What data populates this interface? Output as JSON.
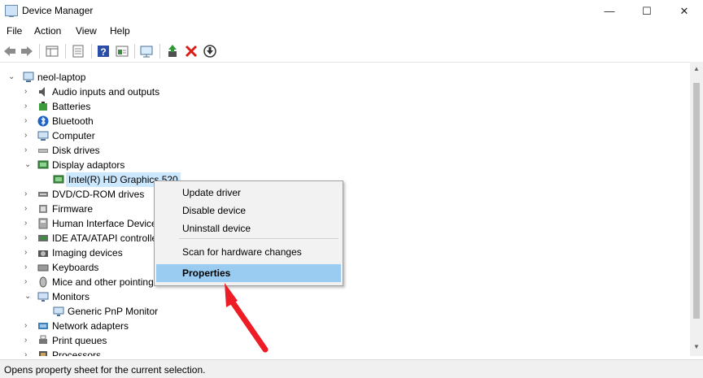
{
  "window": {
    "title": "Device Manager",
    "minimize_glyph": "—",
    "maximize_glyph": "☐",
    "close_glyph": "✕"
  },
  "menu": [
    "File",
    "Action",
    "View",
    "Help"
  ],
  "toolbar_icons": [
    "back-icon",
    "forward-icon",
    "show-hide-tree-icon",
    "properties-icon",
    "help-icon",
    "action-pane-icon",
    "monitor-icon",
    "update-driver-icon",
    "uninstall-icon",
    "download-icon"
  ],
  "tree": {
    "root": "neol-laptop",
    "items": [
      {
        "label": "Audio inputs and outputs",
        "icon": "speaker-icon",
        "expanded": false
      },
      {
        "label": "Batteries",
        "icon": "battery-icon",
        "expanded": false
      },
      {
        "label": "Bluetooth",
        "icon": "bluetooth-icon",
        "expanded": false
      },
      {
        "label": "Computer",
        "icon": "computer-icon",
        "expanded": false
      },
      {
        "label": "Disk drives",
        "icon": "disk-drive-icon",
        "expanded": false
      },
      {
        "label": "Display adaptors",
        "icon": "display-adapter-icon",
        "expanded": true,
        "children": [
          {
            "label": "Intel(R) HD Graphics 520",
            "icon": "display-adapter-icon",
            "selected": true
          }
        ]
      },
      {
        "label": "DVD/CD-ROM drives",
        "icon": "dvd-icon",
        "expanded": false
      },
      {
        "label": "Firmware",
        "icon": "firmware-icon",
        "expanded": false
      },
      {
        "label": "Human Interface Devices",
        "icon": "hid-icon",
        "expanded": false
      },
      {
        "label": "IDE ATA/ATAPI controllers",
        "icon": "ide-icon",
        "expanded": false
      },
      {
        "label": "Imaging devices",
        "icon": "camera-icon",
        "expanded": false
      },
      {
        "label": "Keyboards",
        "icon": "keyboard-icon",
        "expanded": false
      },
      {
        "label": "Mice and other pointing devices",
        "icon": "mouse-icon",
        "expanded": false
      },
      {
        "label": "Monitors",
        "icon": "monitor-icon",
        "expanded": true,
        "children": [
          {
            "label": "Generic PnP Monitor",
            "icon": "monitor-icon"
          }
        ]
      },
      {
        "label": "Network adapters",
        "icon": "network-icon",
        "expanded": false
      },
      {
        "label": "Print queues",
        "icon": "printer-icon",
        "expanded": false
      },
      {
        "label": "Processors",
        "icon": "processor-icon",
        "expanded": false
      }
    ]
  },
  "context_menu": {
    "items": [
      {
        "label": "Update driver"
      },
      {
        "label": "Disable device"
      },
      {
        "label": "Uninstall device"
      },
      {
        "label": "Scan for hardware changes"
      },
      {
        "label": "Properties",
        "highlighted": true,
        "bold": true
      }
    ]
  },
  "status": "Opens property sheet for the current selection.",
  "colors": {
    "selection": "#cce8ff",
    "menu_highlight": "#99ccf0",
    "arrow": "#ee1c25"
  }
}
